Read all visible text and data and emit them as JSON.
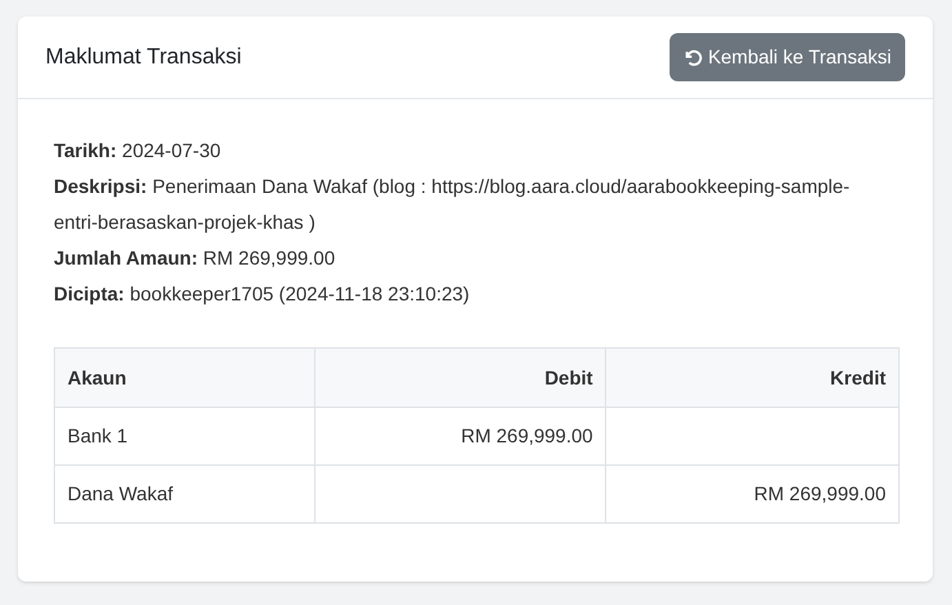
{
  "card": {
    "title": "Maklumat Transaksi",
    "back_button": {
      "label": "Kembali ke Transaksi"
    }
  },
  "details": [
    {
      "label": "Tarikh:",
      "value": "2024-07-30"
    },
    {
      "label": "Deskripsi:",
      "value": "Penerimaan Dana Wakaf (blog : https://blog.aara.cloud/aarabookkeeping-sample-entri-berasaskan-projek-khas )"
    },
    {
      "label": "Jumlah Amaun:",
      "value": "RM 269,999.00"
    },
    {
      "label": "Dicipta:",
      "value": "bookkeeper1705 (2024-11-18 23:10:23)"
    }
  ],
  "table": {
    "columns": [
      "Akaun",
      "Debit",
      "Kredit"
    ],
    "rows": [
      [
        "Bank 1",
        "RM 269,999.00",
        ""
      ],
      [
        "Dana Wakaf",
        "",
        "RM 269,999.00"
      ]
    ]
  }
}
